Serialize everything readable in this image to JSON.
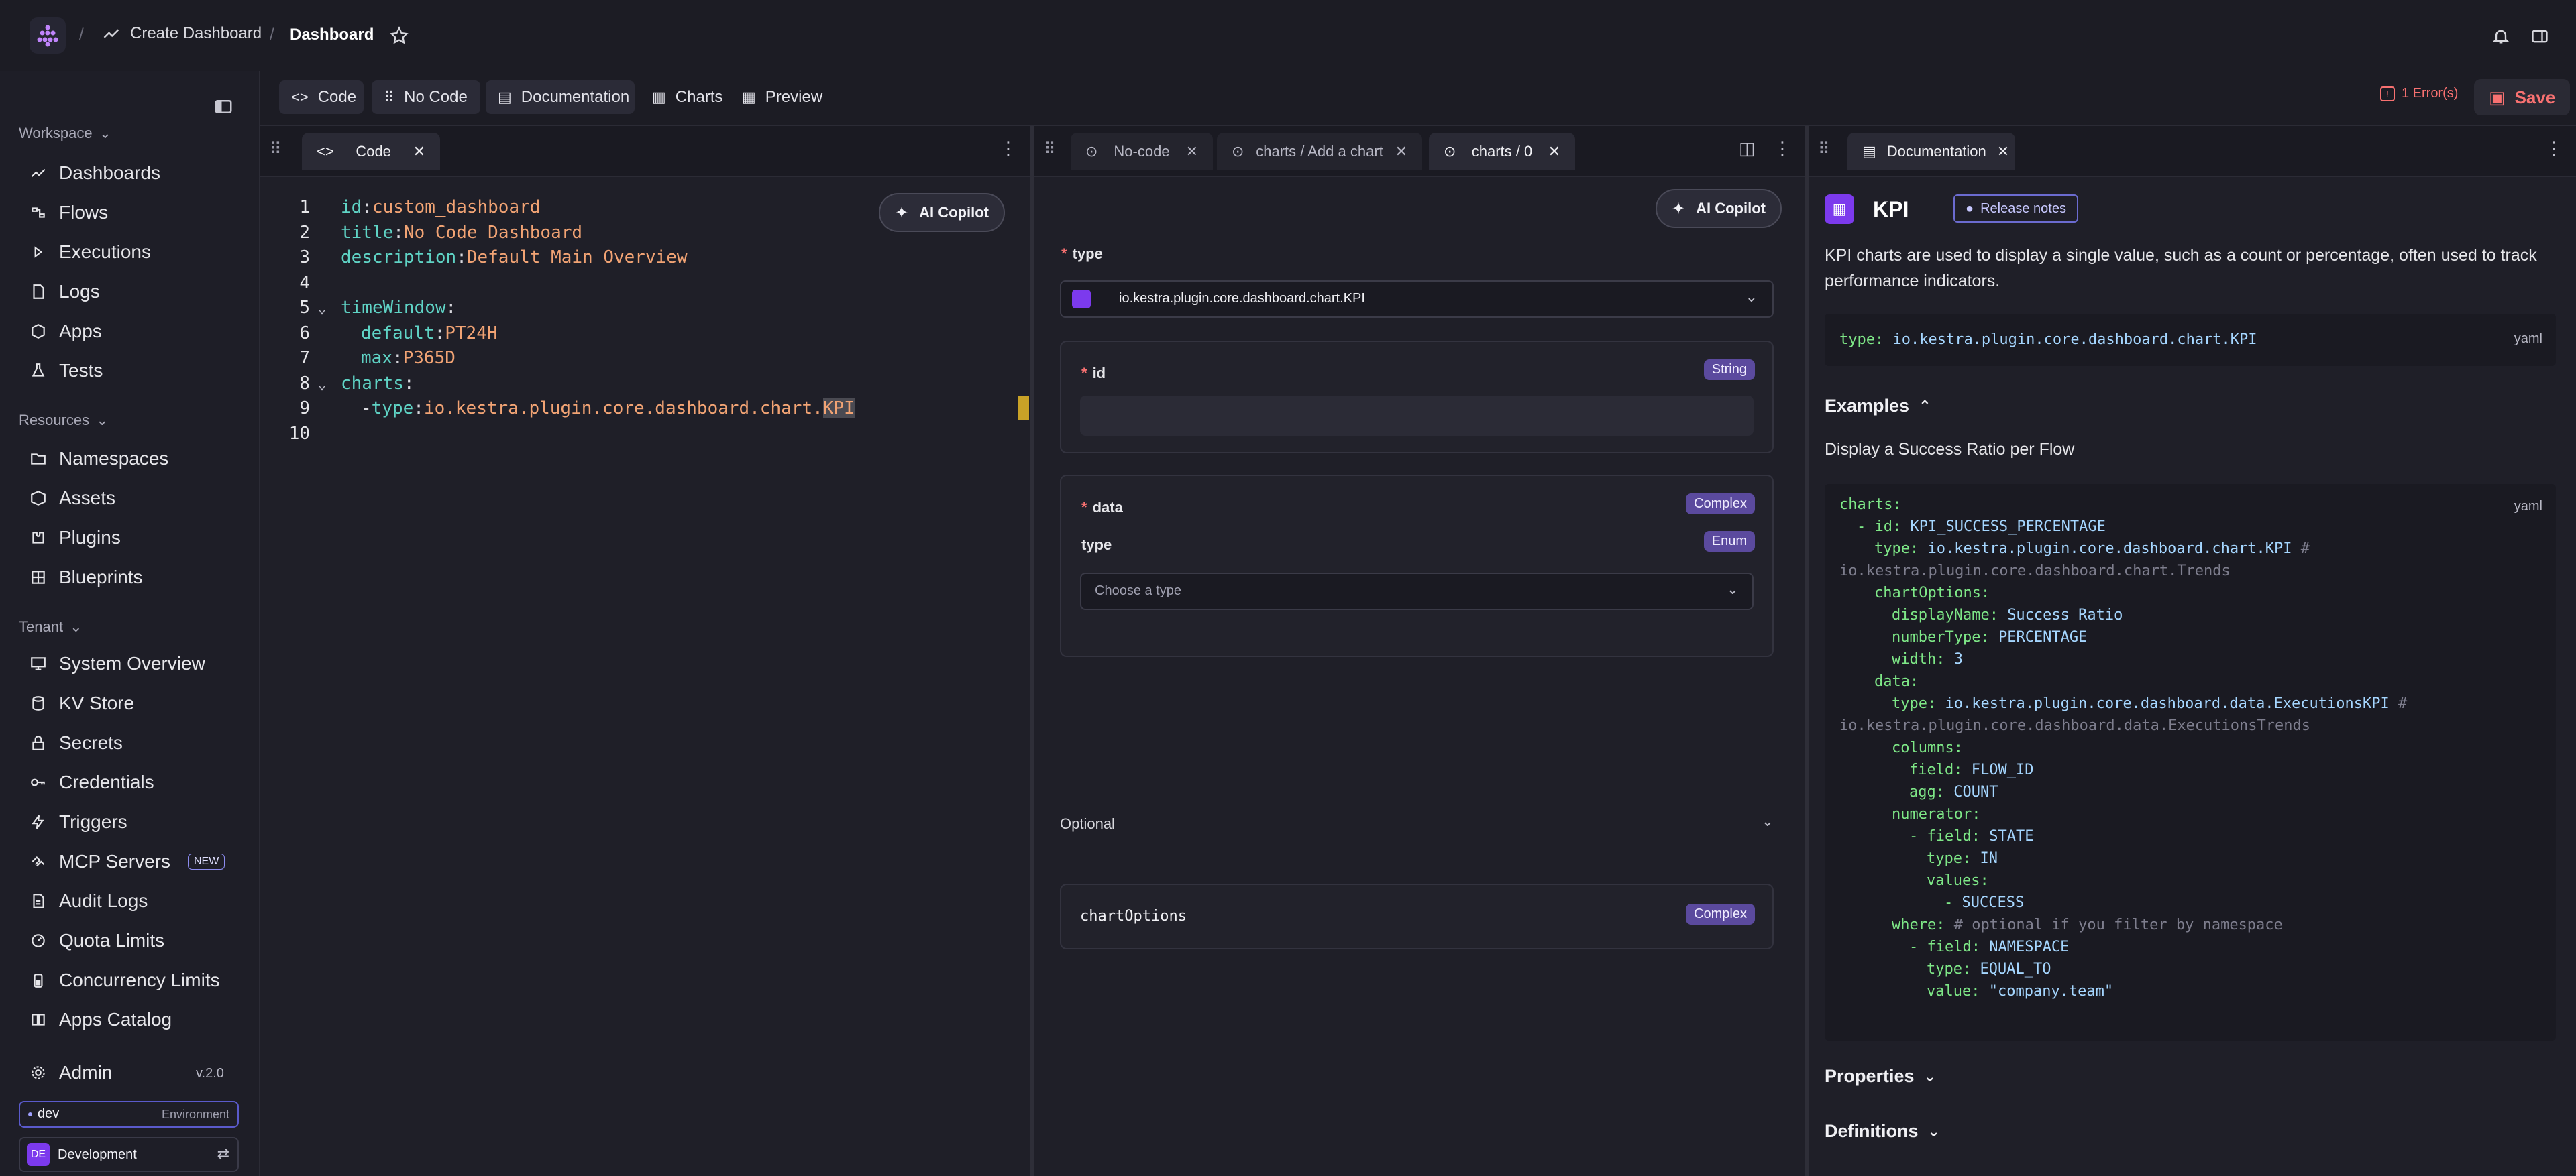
{
  "topbar": {
    "crumb_parent": "Create Dashboard",
    "crumb_current": "Dashboard",
    "separator": "/"
  },
  "toolbar": {
    "code": "Code",
    "nocode": "No Code",
    "documentation": "Documentation",
    "charts": "Charts",
    "preview": "Preview",
    "errors": "1 Error(s)",
    "save": "Save"
  },
  "sidebar": {
    "workspace": "Workspace",
    "workspace_items": [
      "Dashboards",
      "Flows",
      "Executions",
      "Logs",
      "Apps",
      "Tests"
    ],
    "resources": "Resources",
    "resources_items": [
      "Namespaces",
      "Assets",
      "Plugins",
      "Blueprints"
    ],
    "tenant": "Tenant",
    "tenant_items": [
      "System Overview",
      "KV Store",
      "Secrets",
      "Credentials",
      "Triggers",
      "MCP Servers",
      "Audit Logs",
      "Quota Limits",
      "Concurrency Limits",
      "Apps Catalog"
    ],
    "new_badge": "NEW",
    "admin": "Admin",
    "version": "v.2.0",
    "env_name": "dev",
    "env_label": "Environment",
    "tenant_initials": "DE",
    "tenant_name": "Development"
  },
  "code_pane": {
    "tab": "Code",
    "ai_button": "AI Copilot",
    "lines": [
      {
        "n": "1",
        "key": "id",
        "sep": ": ",
        "val": "custom_dashboard",
        "indent": 0
      },
      {
        "n": "2",
        "key": "title",
        "sep": ": ",
        "val": "No Code Dashboard",
        "indent": 0
      },
      {
        "n": "3",
        "key": "description",
        "sep": ": ",
        "val": "Default Main Overview",
        "indent": 0
      },
      {
        "n": "4",
        "key": "",
        "sep": "",
        "val": "",
        "indent": 0
      },
      {
        "n": "5",
        "key": "timeWindow",
        "sep": ":",
        "val": "",
        "indent": 0
      },
      {
        "n": "6",
        "key": "default",
        "sep": ": ",
        "val": "PT24H",
        "indent": 1
      },
      {
        "n": "7",
        "key": "max",
        "sep": ": ",
        "val": "P365D",
        "indent": 1
      },
      {
        "n": "8",
        "key": "charts",
        "sep": ":",
        "val": "",
        "indent": 0
      },
      {
        "n": "9",
        "key": "type",
        "sep": ": ",
        "val": "io.kestra.plugin.core.dashboard.chart.",
        "indent": 1,
        "dash": "- ",
        "highlight": "KPI"
      },
      {
        "n": "10",
        "key": "",
        "sep": "",
        "val": "",
        "indent": 0
      }
    ]
  },
  "nocode_pane": {
    "tabs": [
      "No-code",
      "charts / Add a chart",
      "charts / 0"
    ],
    "ai_button": "AI Copilot",
    "type_label": "type",
    "type_value": "io.kestra.plugin.core.dashboard.chart.KPI",
    "id_label": "id",
    "id_badge": "String",
    "data_label": "data",
    "data_badge": "Complex",
    "data_type_label": "type",
    "data_type_badge": "Enum",
    "choose_type": "Choose a type",
    "optional": "Optional",
    "chart_options": "chartOptions",
    "chart_options_badge": "Complex"
  },
  "doc_pane": {
    "tab": "Documentation",
    "title": "KPI",
    "release_notes": "Release notes",
    "description": "KPI charts are used to display a single value, such as a count or percentage, often used to track performance indicators.",
    "type_line_key": "type:",
    "type_line_val": "io.kestra.plugin.core.dashboard.chart.KPI",
    "yaml_label": "yaml",
    "examples": "Examples",
    "example_title": "Display a Success Ratio per Flow",
    "properties": "Properties",
    "definitions": "Definitions",
    "example_lines": [
      {
        "i": 0,
        "k": "charts:",
        "v": "",
        "c": ""
      },
      {
        "i": 1,
        "k": "- id: ",
        "v": "KPI_SUCCESS_PERCENTAGE",
        "c": ""
      },
      {
        "i": 2,
        "k": "type: ",
        "v": "io.kestra.plugin.core.dashboard.chart.KPI",
        "c": " #"
      },
      {
        "i": 0,
        "k": "",
        "v": "",
        "c": "io.kestra.plugin.core.dashboard.chart.Trends"
      },
      {
        "i": 2,
        "k": "chartOptions:",
        "v": "",
        "c": ""
      },
      {
        "i": 3,
        "k": "displayName: ",
        "v": "Success Ratio",
        "c": ""
      },
      {
        "i": 3,
        "k": "numberType: ",
        "v": "PERCENTAGE",
        "c": ""
      },
      {
        "i": 3,
        "k": "width: ",
        "v": "3",
        "c": ""
      },
      {
        "i": 2,
        "k": "data:",
        "v": "",
        "c": ""
      },
      {
        "i": 3,
        "k": "type: ",
        "v": "io.kestra.plugin.core.dashboard.data.ExecutionsKPI",
        "c": " #"
      },
      {
        "i": 0,
        "k": "",
        "v": "",
        "c": "io.kestra.plugin.core.dashboard.data.ExecutionsTrends"
      },
      {
        "i": 3,
        "k": "columns:",
        "v": "",
        "c": ""
      },
      {
        "i": 4,
        "k": "field: ",
        "v": "FLOW_ID",
        "c": ""
      },
      {
        "i": 4,
        "k": "agg: ",
        "v": "COUNT",
        "c": ""
      },
      {
        "i": 3,
        "k": "numerator:",
        "v": "",
        "c": ""
      },
      {
        "i": 4,
        "k": "- field: ",
        "v": "STATE",
        "c": ""
      },
      {
        "i": 5,
        "k": "type: ",
        "v": "IN",
        "c": ""
      },
      {
        "i": 5,
        "k": "values:",
        "v": "",
        "c": ""
      },
      {
        "i": 6,
        "k": "- ",
        "v": "SUCCESS",
        "c": ""
      },
      {
        "i": 3,
        "k": "where: ",
        "v": "",
        "c": "# optional if you filter by namespace"
      },
      {
        "i": 4,
        "k": "- field: ",
        "v": "NAMESPACE",
        "c": ""
      },
      {
        "i": 5,
        "k": "type: ",
        "v": "EQUAL_TO",
        "c": ""
      },
      {
        "i": 5,
        "k": "value: ",
        "v": "\"company.team\"",
        "c": ""
      }
    ]
  }
}
